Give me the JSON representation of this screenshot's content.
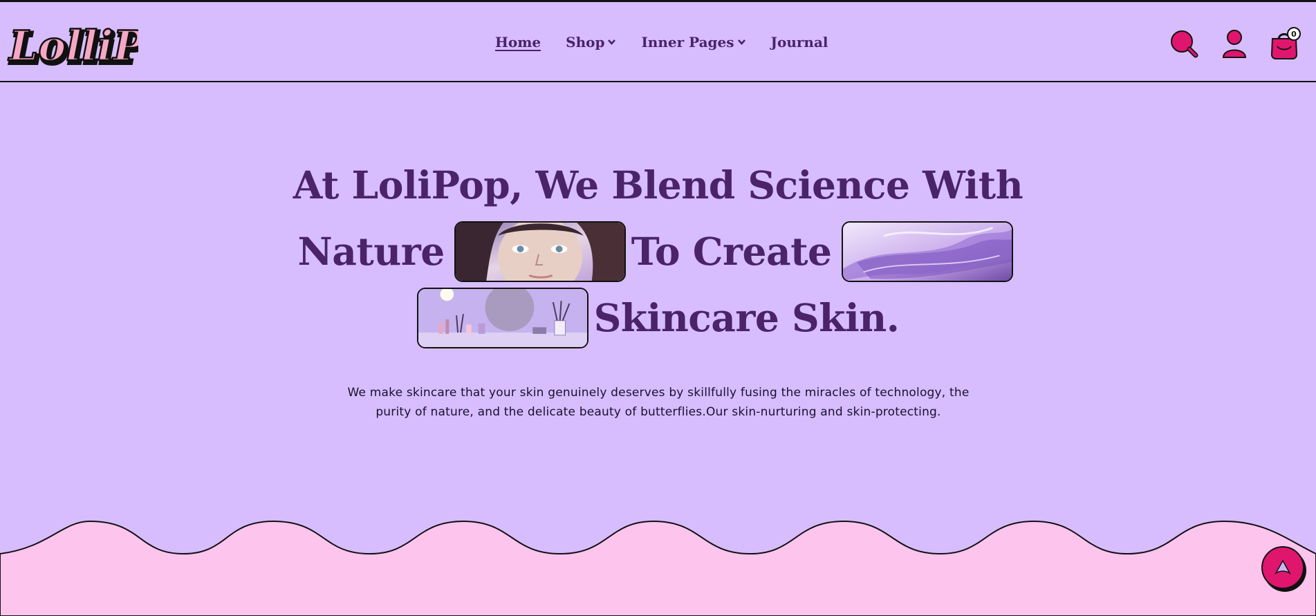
{
  "brand": {
    "logo_text": "LolliPop"
  },
  "nav": {
    "items": [
      {
        "label": "Home",
        "active": true,
        "dropdown": false
      },
      {
        "label": "Shop",
        "active": false,
        "dropdown": true
      },
      {
        "label": "Inner Pages",
        "active": false,
        "dropdown": true
      },
      {
        "label": "Journal",
        "active": false,
        "dropdown": false
      }
    ]
  },
  "header_icons": {
    "search": "search-icon",
    "account": "user-icon",
    "cart": "shopping-bag-icon",
    "cart_count": "0"
  },
  "hero": {
    "line1": "At LoliPop, We Blend Science With",
    "line2_a": "Nature",
    "line2_b": "To Create",
    "line3": "Skincare Skin.",
    "images": [
      "woman-face-image",
      "purple-liquid-image",
      "vanity-mirror-image"
    ],
    "description": "We make skincare that your skin genuinely deserves by skillfully fusing the miracles of technology, the purity of nature, and the delicate beauty of butterflies.Our skin-nurturing and skin-protecting."
  },
  "scroll_top": {
    "icon": "arrow-up-icon"
  },
  "colors": {
    "background": "#d7bdfe",
    "heading": "#4a2368",
    "accent_pink": "#e0166e",
    "wave_pink": "#fdc4ee",
    "outline": "#111111"
  }
}
